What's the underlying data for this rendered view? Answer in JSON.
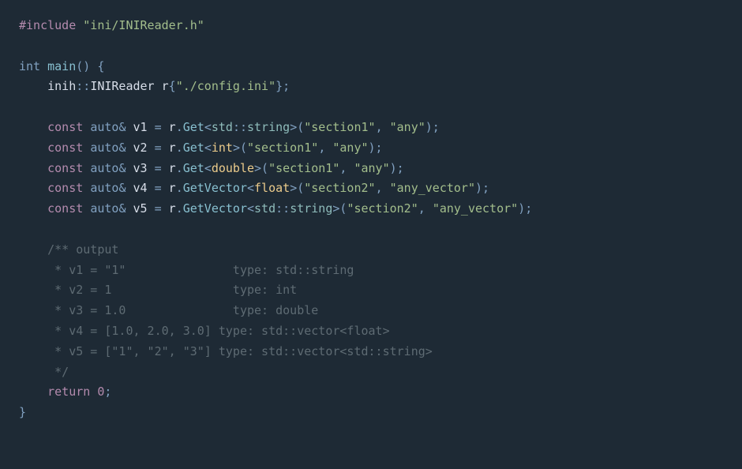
{
  "code": {
    "include_directive": "#include",
    "include_path": "\"ini/INIReader.h\"",
    "int": "int",
    "main": "main",
    "namespace": "inih",
    "reader_class": "INIReader",
    "var_r": "r",
    "config_path": "\"./config.ini\"",
    "const": "const",
    "auto": "auto",
    "v1": "v1",
    "v2": "v2",
    "v3": "v3",
    "v4": "v4",
    "v5": "v5",
    "get": "Get",
    "getvector": "GetVector",
    "std": "std",
    "string": "string",
    "t_int": "int",
    "t_double": "double",
    "t_float": "float",
    "section1": "\"section1\"",
    "section2": "\"section2\"",
    "any": "\"any\"",
    "any_vector": "\"any_vector\"",
    "return": "return",
    "zero": "0",
    "comment_l1": "/** output",
    "comment_l2": " * v1 = \"1\"               type: std::string",
    "comment_l3": " * v2 = 1                 type: int",
    "comment_l4": " * v3 = 1.0               type: double",
    "comment_l5": " * v4 = [1.0, 2.0, 3.0] type: std::vector<float>",
    "comment_l6": " * v5 = [\"1\", \"2\", \"3\"] type: std::vector<std::string>",
    "comment_l7": " */"
  }
}
